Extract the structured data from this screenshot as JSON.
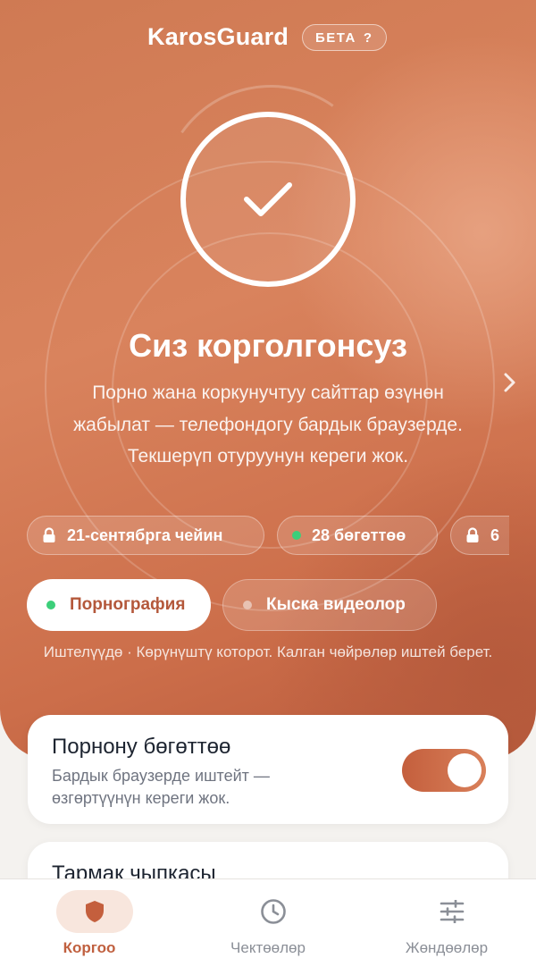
{
  "header": {
    "title": "KarosGuard",
    "beta_label": "БЕТА",
    "beta_help": "?"
  },
  "status": {
    "title": "Сиз корголгонсуз",
    "description": "Порно жана коркунучтуу сайттар өзүнөн жабылат — телефондогу бардык браузерде. Текшерүп отуруунун кереги жок."
  },
  "chips": [
    {
      "label": "21-сентябрга чейин",
      "icon": "lock-icon"
    },
    {
      "label": "28 бөгөттөө",
      "icon": "status-dot",
      "color": "#3ccf7a"
    },
    {
      "label": "6",
      "icon": "lock-icon"
    }
  ],
  "modes": {
    "active": {
      "label": "Порнография",
      "dot_color": "#3ccf7a"
    },
    "inactive": {
      "label": "Кыска видеолор",
      "dot_color": "#e8c2b3"
    }
  },
  "note": "Иштелүүдө · Көрүнүштү которот. Калган чөйрөлөр иштей берет.",
  "cards": {
    "block_porn": {
      "title": "Порнону бөгөттөө",
      "subtitle": "Бардык браузерде иштейт — өзгөртүүнүн кереги жок.",
      "enabled": true
    },
    "network": {
      "title": "Тармак чыпкасы"
    }
  },
  "nav": [
    {
      "label": "Коргоо",
      "icon": "shield-icon",
      "active": true
    },
    {
      "label": "Чектөөлөр",
      "icon": "clock-icon",
      "active": false
    },
    {
      "label": "Жөндөөлөр",
      "icon": "sliders-icon",
      "active": false
    }
  ],
  "colors": {
    "accent": "#c0603f",
    "hero_start": "#cf7a53",
    "hero_end": "#b8593b",
    "ok_green": "#3ccf7a"
  }
}
